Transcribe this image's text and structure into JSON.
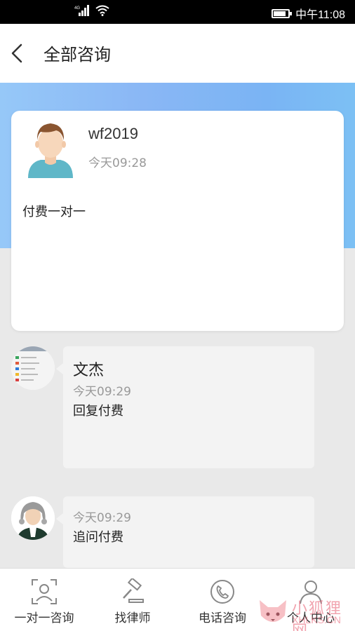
{
  "status_bar": {
    "network": "4G",
    "carrier_time": "中午11:08",
    "battery_level": 0.85
  },
  "header": {
    "title": "全部咨询"
  },
  "consultation": {
    "username": "wf2019",
    "time": "今天09:28",
    "content": "付费一对一"
  },
  "replies": [
    {
      "name": "文杰",
      "time": "今天09:29",
      "text": "回复付费"
    },
    {
      "name": "",
      "time": "今天09:29",
      "text": "追问付费"
    }
  ],
  "tabs": [
    {
      "label": "一对一咨询",
      "icon": "face-id-icon"
    },
    {
      "label": "找律师",
      "icon": "gavel-icon"
    },
    {
      "label": "电话咨询",
      "icon": "phone-icon"
    },
    {
      "label": "个人中心",
      "icon": "person-icon"
    }
  ],
  "watermark": {
    "text": "小狐狸网",
    "url": "XHLKS.CN"
  },
  "colors": {
    "hero_gradient_start": "#96c8f8",
    "hero_gradient_end": "#7cc0f4",
    "background": "#e9e9e9"
  }
}
